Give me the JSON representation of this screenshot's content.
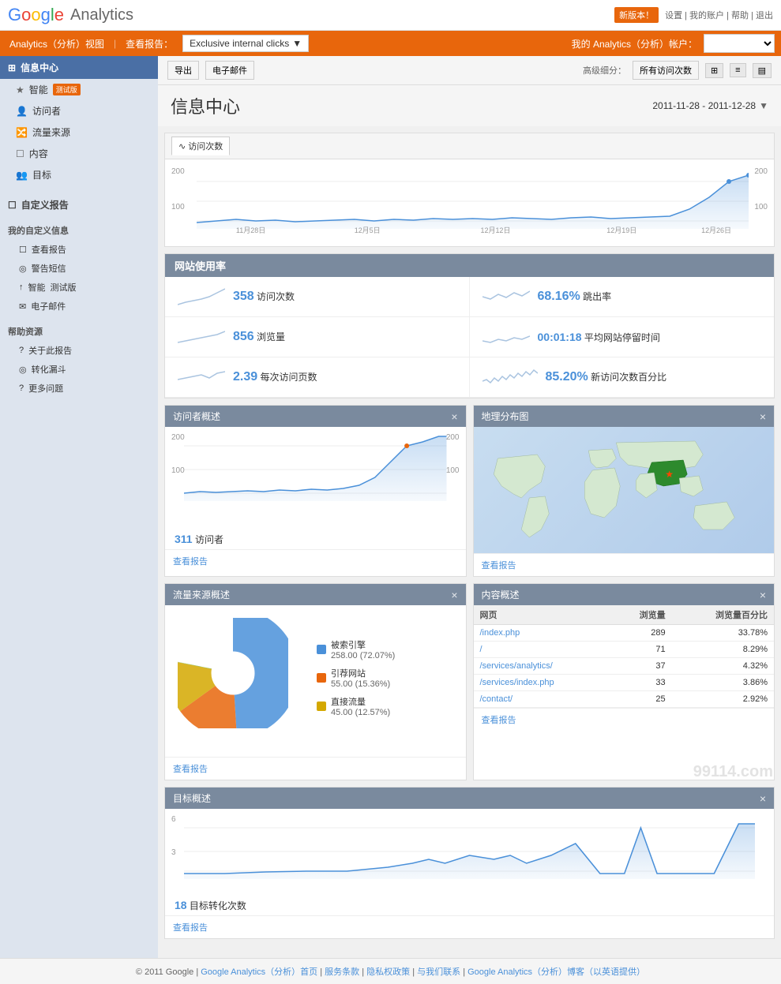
{
  "header": {
    "logo_google": "Google",
    "logo_analytics": "Analytics",
    "new_version_label": "新版本！",
    "header_links": "设置 | 我的账户 | 帮助 | 退出"
  },
  "navbar": {
    "analytics_label": "Analytics（分析）视图",
    "separator1": "|",
    "view_report_label": "查看报告：",
    "dropdown_value": "Exclusive internal clicks",
    "my_analytics_label": "我的 Analytics（分析）帐户：",
    "account_placeholder": ""
  },
  "sidebar": {
    "info_center_label": "信息中心",
    "info_center_icon": "⊞",
    "smart_goals_label": "智能",
    "smart_goals_badge": "测试版",
    "visitor_label": "访问者",
    "visitor_icon": "👤",
    "traffic_label": "流量来源",
    "traffic_icon": "🔀",
    "content_label": "内容",
    "content_icon": "☐",
    "goals_label": "目标",
    "goals_icon": "👥",
    "custom_reports_label": "自定义报告",
    "custom_reports_icon": "☐",
    "my_custom_info_label": "我的自定义信息",
    "my_reports_label": "查看报告",
    "my_reports_icon": "☐",
    "alert_label": "警告短信",
    "alert_icon": "◎",
    "intelligence_label": "智能",
    "intelligence_icon": "↑",
    "intelligence_badge": "测试版",
    "email_label": "电子邮件",
    "email_icon": "✉",
    "help_label": "帮助资源",
    "about_report_label": "关于此报告",
    "optimize_label": "转化漏斗",
    "more_help_label": "更多问题",
    "items": [
      {
        "label": "访问者"
      },
      {
        "label": "流量来源"
      },
      {
        "label": "内容"
      },
      {
        "label": "目标"
      }
    ]
  },
  "content": {
    "export_label": "导出",
    "email_btn_label": "电子邮件",
    "advanced_segments_label": "高级细分：",
    "all_visitors_label": "所有访问次数",
    "page_title": "信息中心",
    "date_range": "2011-11-28 - 2011-12-28",
    "chart_tab_visits": "访问次数",
    "chart_y_max": "200",
    "chart_y_mid": "100",
    "chart_y_max_right": "200",
    "chart_y_mid_right": "100",
    "stats_section_title": "网站使用率",
    "stats": [
      {
        "value": "358",
        "label": "访问次数",
        "sparkline": "visits"
      },
      {
        "value": "68.16%",
        "label": "跳出率",
        "sparkline": "bounce"
      },
      {
        "value": "856",
        "label": "浏览量",
        "sparkline": "pageviews"
      },
      {
        "value": "00:01:18",
        "label": "平均网站停留时间",
        "sparkline": "time"
      },
      {
        "value": "2.39",
        "label": "每次访问页数",
        "sparkline": "pages"
      },
      {
        "value": "85.20%",
        "label": "新访问次数百分比",
        "sparkline": "new"
      }
    ],
    "visitor_overview_title": "访问者概述",
    "visitor_count": "311",
    "visitor_count_label": "访问者",
    "view_report_label": "查看报告",
    "geo_title": "地理分布图",
    "traffic_source_title": "流量来源概述",
    "traffic_legend": [
      {
        "label": "被索引擎",
        "value": "258.00 (72.07%)",
        "color": "#4a90d9"
      },
      {
        "label": "引荐网站",
        "value": "55.00 (15.36%)",
        "color": "#e8660c"
      },
      {
        "label": "直接流量",
        "value": "45.00 (12.57%)",
        "color": "#d4a800"
      }
    ],
    "content_overview_title": "内容概述",
    "content_table_headers": [
      "网页",
      "浏览量",
      "浏览量百分比"
    ],
    "content_table_rows": [
      {
        "page": "/index.php",
        "views": "289",
        "pct": "33.78%"
      },
      {
        "page": "/",
        "views": "71",
        "pct": "8.29%"
      },
      {
        "page": "/services/analytics/",
        "views": "37",
        "pct": "4.32%"
      },
      {
        "page": "/services/index.php",
        "views": "33",
        "pct": "3.86%"
      },
      {
        "page": "/contact/",
        "views": "25",
        "pct": "2.92%"
      }
    ],
    "goal_overview_title": "目标概述",
    "goal_count": "18",
    "goal_count_label": "目标转化次数",
    "goal_y_max": "6",
    "goal_y_mid": "3"
  },
  "footer": {
    "copyright": "© 2011 Google",
    "links": [
      "Google Analytics（分析）首页",
      "服务条款",
      "隐私权政策",
      "与我们联系",
      "Google Analytics（分析）博客（以英语提供）"
    ]
  },
  "watermark": "99114.com"
}
